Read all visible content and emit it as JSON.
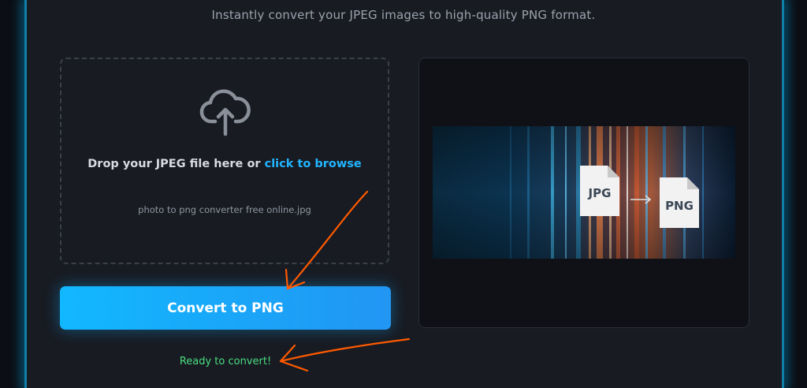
{
  "header": {
    "subtitle": "Instantly convert your JPEG images to high-quality PNG format."
  },
  "upload": {
    "icon": "cloud-upload-icon",
    "prompt_text": "Drop your JPEG file here or ",
    "browse_link": "click to browse",
    "file_name": "photo to png converter free online.jpg"
  },
  "actions": {
    "convert_label": "Convert to PNG"
  },
  "status": {
    "message": "Ready to convert!"
  },
  "preview": {
    "from_label": "JPG",
    "to_label": "PNG"
  },
  "colors": {
    "accent": "#22b5ff",
    "button_start": "#12b8ff",
    "button_end": "#2196f3",
    "status": "#4ade80",
    "annotation": "#ff5a00"
  }
}
